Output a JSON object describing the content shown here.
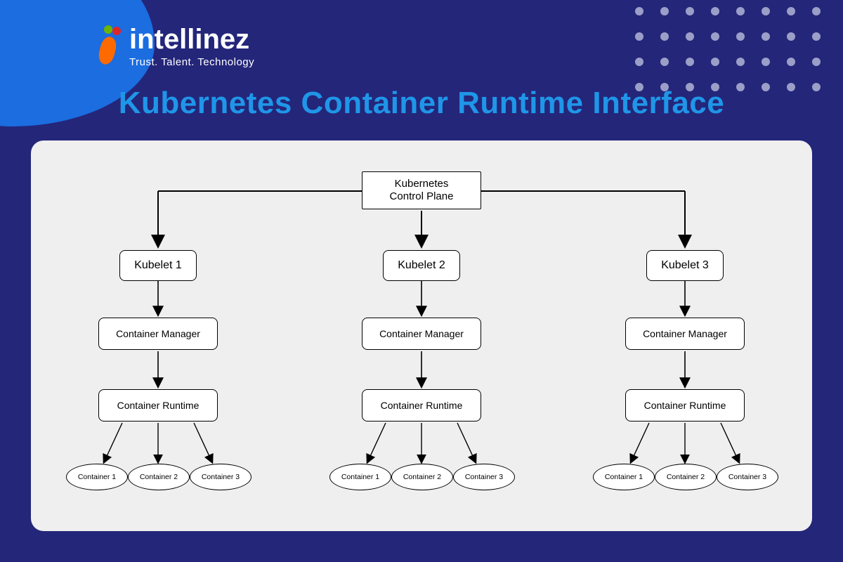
{
  "brand": {
    "name": "intellinez",
    "tagline": "Trust. Talent. Technology"
  },
  "title": "Kubernetes Container Runtime Interface",
  "diagram": {
    "root": "Kubernetes\nControl Plane",
    "columnA": {
      "kubelet": "Kubelet 1",
      "manager": "Container Manager",
      "runtime": "Container Runtime",
      "containers": [
        "Container 1",
        "Container 2",
        "Container 3"
      ]
    },
    "columnB": {
      "kubelet": "Kubelet 2",
      "manager": "Container Manager",
      "runtime": "Container Runtime",
      "containers": [
        "Container 1",
        "Container 2",
        "Container 3"
      ]
    },
    "columnC": {
      "kubelet": "Kubelet 3",
      "manager": "Container Manager",
      "runtime": "Container Runtime",
      "containers": [
        "Container 1",
        "Container 2",
        "Container 3"
      ]
    }
  }
}
